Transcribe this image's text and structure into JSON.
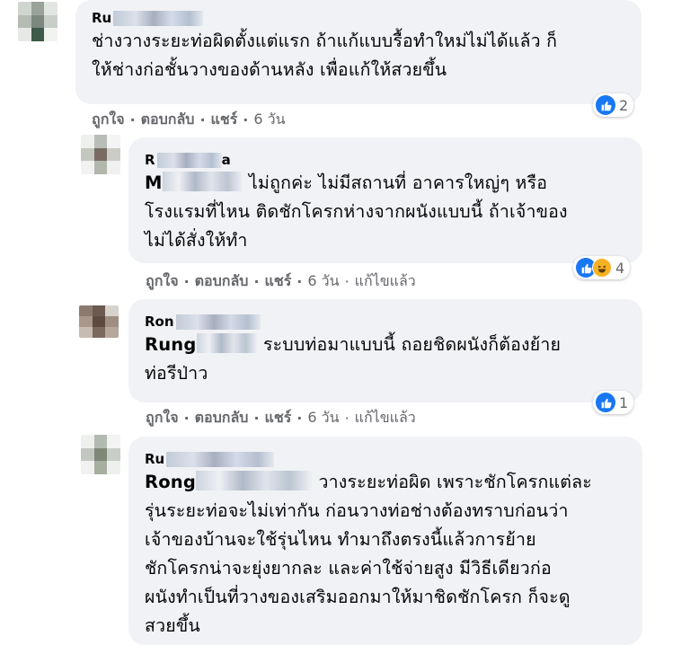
{
  "actions": {
    "like": "ถูกใจ",
    "sep": "·",
    "reply": "ตอบกลับ",
    "share": "แชร์",
    "edited": "แก้ไขแล้ว"
  },
  "comments": [
    {
      "author": "Ru",
      "text_lines": [
        "ช่างวางระยะท่อผิดตั้งแต่แรก ถ้าแก้แบบรื้อทำใหม่ไม่ได้แล้ว ก็",
        "ให้ช่างก่อชั้นวางของด้านหลัง เพื่อแก้ให้สวยขึ้น"
      ],
      "time": "6 วัน",
      "reaction_count": "2"
    },
    {
      "author": "R",
      "author_tail": "a",
      "mention": "M",
      "text_first": "ไม่ถูกค่ะ ไม่มีสถานที่ อาคารใหญ่ๆ หรือ",
      "text_lines": [
        "โรงแรมที่ไหน ติดชักโครกห่างจากผนังแบบนี้ ถ้าเจ้าของ",
        "ไม่ได้สั่งให้ทำ"
      ],
      "time": "6 วัน",
      "reaction_count": "4"
    },
    {
      "author": "Ron",
      "mention": "Rung",
      "text_first": "ระบบท่อมาแบบนี้ ถอยชิดผนังก็ต้องย้าย",
      "text_lines": [
        "ท่อรีป่าว"
      ],
      "time": "6 วัน",
      "reaction_count": "1"
    },
    {
      "author": "Ru",
      "mention": "Rong",
      "text_first": "วางระยะท่อผิด เพราะชักโครกแต่ละ",
      "text_lines": [
        "รุ่นระยะท่อจะไม่เท่ากัน ก่อนวางท่อช่างต้องทราบก่อนว่า",
        "เจ้าของบ้านจะใช้รุ่นไหน ทำมาถึงตรงนี้แล้วการย้าย",
        "ชักโครกน่าจะยุ่งยากละ และค่าใช้จ่ายสูง มีวิธีเดียวก่อ",
        "ผนังทำเป็นที่วางของเสริมออกมาให้มาชิดชักโครก ก็จะดู",
        "สวยขึ้น"
      ]
    }
  ],
  "colors": {
    "bubble": "#f0f2f5",
    "meta_text": "#65676b",
    "like_blue": "#1877f2",
    "haha_yellow": "#f7b125"
  }
}
